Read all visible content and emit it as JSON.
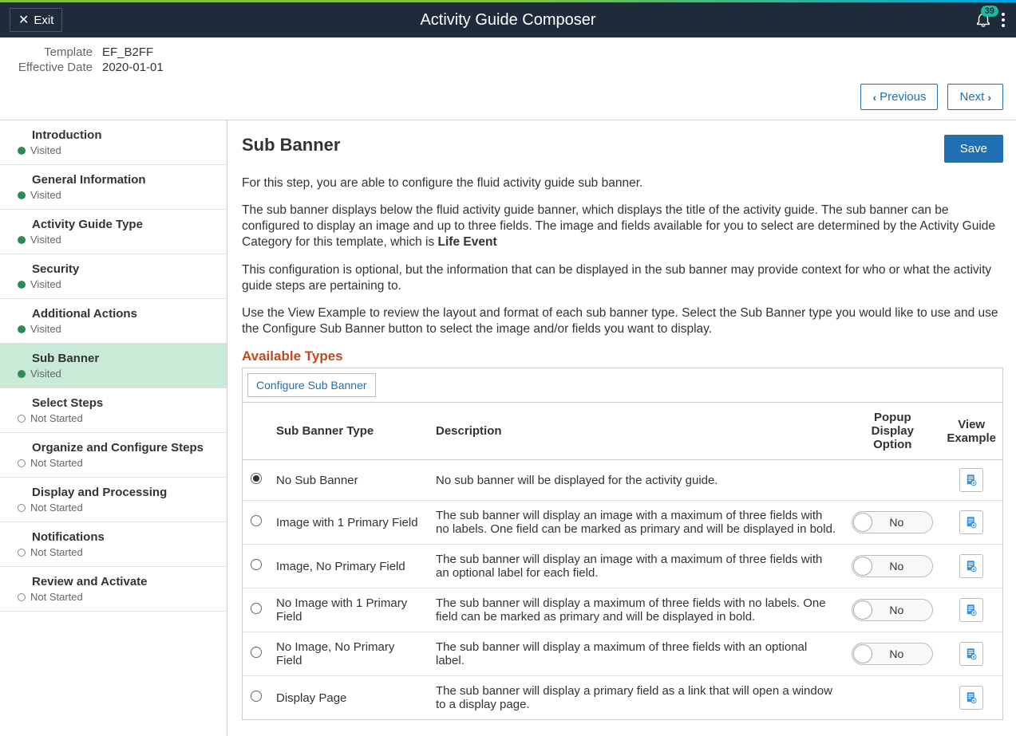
{
  "header": {
    "title": "Activity Guide Composer",
    "exit_label": "Exit",
    "notification_count": "39"
  },
  "meta": {
    "template_label": "Template",
    "template_value": "EF_B2FF",
    "effdate_label": "Effective Date",
    "effdate_value": "2020-01-01"
  },
  "nav": {
    "previous": "Previous",
    "next": "Next"
  },
  "sidebar": {
    "status_visited": "Visited",
    "status_notstarted": "Not Started",
    "steps": [
      {
        "label": "Introduction",
        "status": "Visited",
        "kind": "visited"
      },
      {
        "label": "General Information",
        "status": "Visited",
        "kind": "visited"
      },
      {
        "label": "Activity Guide Type",
        "status": "Visited",
        "kind": "visited"
      },
      {
        "label": "Security",
        "status": "Visited",
        "kind": "visited"
      },
      {
        "label": "Additional Actions",
        "status": "Visited",
        "kind": "visited"
      },
      {
        "label": "Sub Banner",
        "status": "Visited",
        "kind": "visited",
        "active": true
      },
      {
        "label": "Select Steps",
        "status": "Not Started",
        "kind": "notstarted"
      },
      {
        "label": "Organize and Configure Steps",
        "status": "Not Started",
        "kind": "notstarted"
      },
      {
        "label": "Display and Processing",
        "status": "Not Started",
        "kind": "notstarted"
      },
      {
        "label": "Notifications",
        "status": "Not Started",
        "kind": "notstarted"
      },
      {
        "label": "Review and Activate",
        "status": "Not Started",
        "kind": "notstarted"
      }
    ]
  },
  "main": {
    "page_title": "Sub Banner",
    "save_label": "Save",
    "intro1": "For this step, you are able to configure the fluid activity guide sub banner.",
    "intro2a": "The sub banner displays below the fluid activity guide banner, which displays the title of the activity guide. The sub banner can be configured to display an image and up to three fields. The image and fields available for you to select are determined by the Activity Guide Category for this template, which is ",
    "intro2b": "Life Event",
    "intro3": "This configuration is optional, but the information that can be displayed in the sub banner may provide context for who or what the activity guide steps are pertaining to.",
    "intro4": "Use the View Example to review the layout and format of each sub banner type. Select the Sub Banner type you would like to use and use the Configure Sub Banner button to select the image and/or fields you want to display.",
    "section_title": "Available Types",
    "configure_label": "Configure Sub Banner",
    "cols": {
      "type": "Sub Banner Type",
      "desc": "Description",
      "popup": "Popup Display Option",
      "view": "View Example"
    },
    "rows": [
      {
        "selected": true,
        "type": "No Sub Banner",
        "desc": "No sub banner will be displayed for the activity guide.",
        "popup": null,
        "view": true
      },
      {
        "selected": false,
        "type": "Image with 1 Primary Field",
        "desc": "The sub banner will display an image with a maximum of three fields with no labels.  One field can be marked as primary and will be displayed in bold.",
        "popup": "No",
        "view": true
      },
      {
        "selected": false,
        "type": "Image, No Primary Field",
        "desc": "The sub banner will display an image with a maximum of three fields with an optional label for each field.",
        "popup": "No",
        "view": true
      },
      {
        "selected": false,
        "type": "No Image with 1 Primary Field",
        "desc": "The sub banner will display a maximum of three fields with no labels.  One field can be marked as primary and will be displayed in bold.",
        "popup": "No",
        "view": true
      },
      {
        "selected": false,
        "type": "No Image, No Primary Field",
        "desc": "The sub banner will display a maximum of three fields with an optional label.",
        "popup": "No",
        "view": true
      },
      {
        "selected": false,
        "type": "Display Page",
        "desc": "The sub banner will display a primary field as a link that will open a window to a display page.",
        "popup": null,
        "view": true
      }
    ]
  }
}
